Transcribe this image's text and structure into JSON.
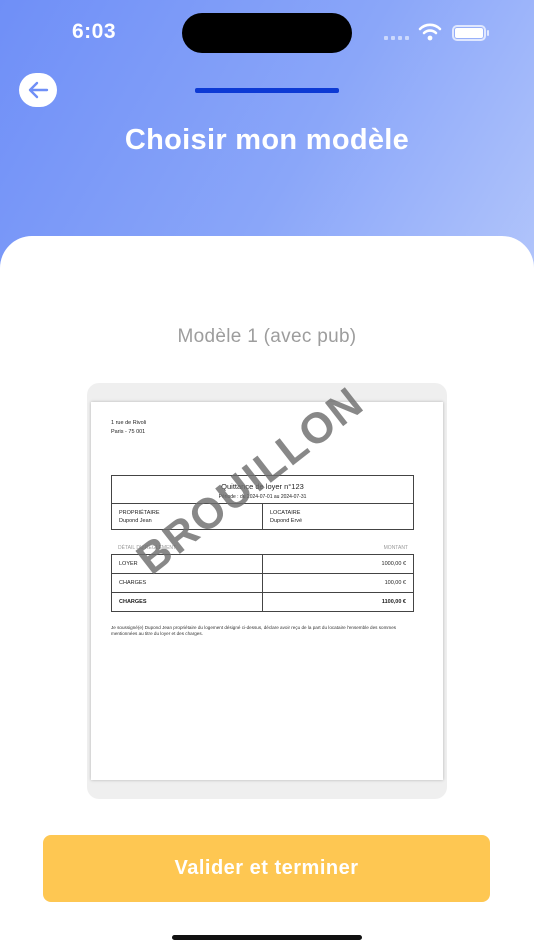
{
  "status_bar": {
    "time": "6:03"
  },
  "header": {
    "title": "Choisir mon modèle"
  },
  "template": {
    "label": "Modèle 1 (avec pub)",
    "watermark": "BROUILLON",
    "document": {
      "address_line1": "1 rue de Rivoli",
      "address_line2": "Paris - 75 001",
      "title": "Quittance de loyer n°123",
      "period": "Période : du 2024-07-01 au 2024-07-31",
      "owner_label": "PROPRIÉTAIRE",
      "owner_name": "Dupond Jean",
      "tenant_label": "LOCATAIRE",
      "tenant_name": "Dupond Ervé",
      "detail_header": "DÉTAIL DU RÈGLEMENT",
      "amount_header": "MONTANT",
      "lines": [
        {
          "label": "LOYER",
          "amount": "1000,00 €"
        },
        {
          "label": "CHARGES",
          "amount": "100,00 €"
        },
        {
          "label": "CHARGES",
          "amount": "1100,00 €"
        }
      ],
      "note": "Je soussigné(e) Dupond Jean propriétaire du logement désigné ci-dessus, déclare avoir reçu de la part du locataire l'ensemble des sommes mentionnées au titre du loyer et des charges."
    }
  },
  "actions": {
    "validate_label": "Valider et terminer"
  },
  "colors": {
    "header_gradient_start": "#6f8ff7",
    "header_gradient_end": "#b3c6fb",
    "progress": "#0d3ad4",
    "primary_button": "#fec752"
  },
  "icons": {
    "back": "arrow-left-icon",
    "wifi": "wifi-icon",
    "battery": "battery-icon",
    "signal": "signal-icon"
  }
}
